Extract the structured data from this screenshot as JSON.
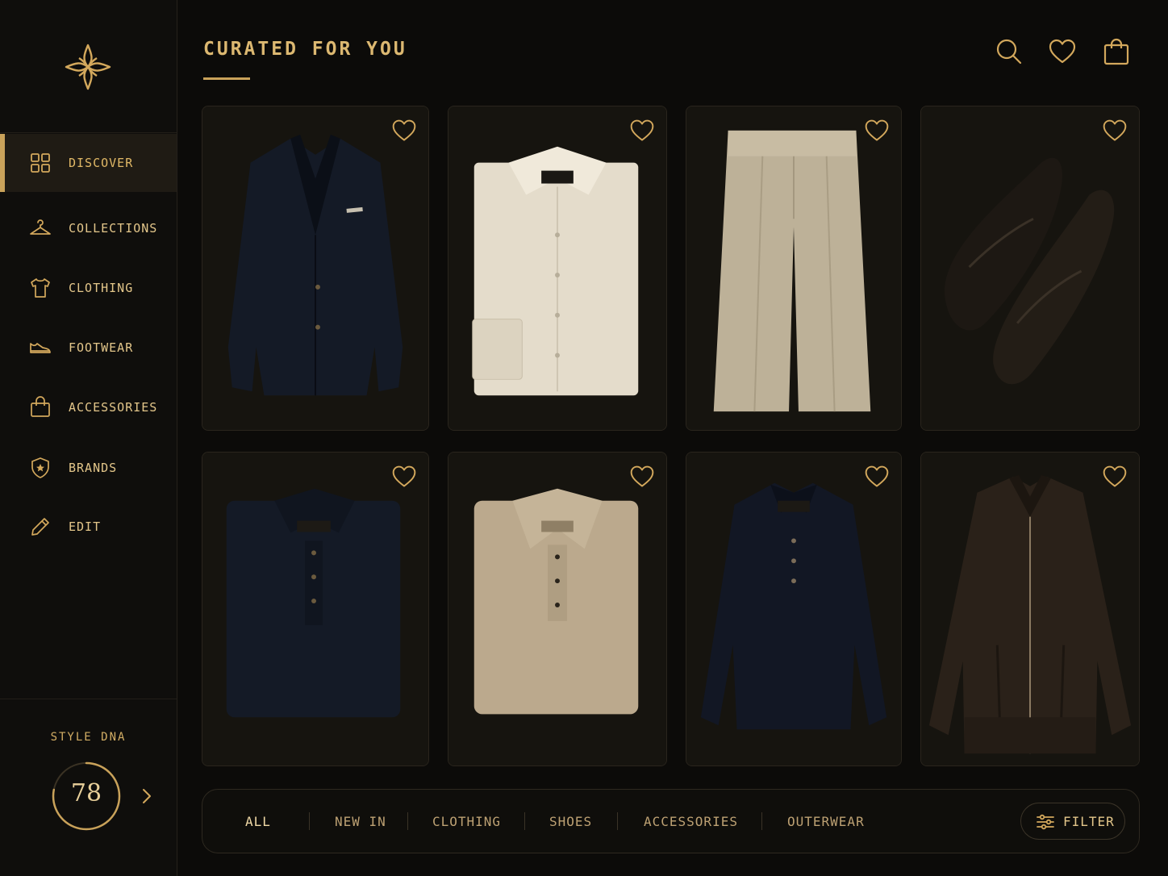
{
  "brand": {
    "logo_icon": "quatrefoil-star-icon"
  },
  "colors": {
    "background": "#0c0b09",
    "accent": "#c9a25a",
    "text": "#d8b46a",
    "card": "#16140f"
  },
  "header": {
    "title": "CURATED FOR YOU",
    "icons": [
      "search-icon",
      "heart-icon",
      "shopping-bag-icon"
    ]
  },
  "sidebar": {
    "items": [
      {
        "label": "DISCOVER",
        "icon": "grid-icon",
        "active": true
      },
      {
        "label": "COLLECTIONS",
        "icon": "hanger-icon",
        "active": false
      },
      {
        "label": "CLOTHING",
        "icon": "tshirt-icon",
        "active": false
      },
      {
        "label": "FOOTWEAR",
        "icon": "shoe-icon",
        "active": false
      },
      {
        "label": "ACCESSORIES",
        "icon": "bag-icon",
        "active": false
      },
      {
        "label": "BRANDS",
        "icon": "shield-star-icon",
        "active": false
      },
      {
        "label": "EDIT",
        "icon": "pencil-icon",
        "active": false
      }
    ],
    "style_dna": {
      "title": "STYLE DNA",
      "score": "78",
      "progress": 0.78
    }
  },
  "products": [
    {
      "item": "navy blazer",
      "icon": "blazer-image"
    },
    {
      "item": "cream dress shirt",
      "icon": "shirt-image"
    },
    {
      "item": "khaki pleated trousers",
      "icon": "trousers-image"
    },
    {
      "item": "black penny loafers",
      "icon": "loafers-image"
    },
    {
      "item": "navy knit polo",
      "icon": "polo-image"
    },
    {
      "item": "beige knit polo",
      "icon": "polo-image"
    },
    {
      "item": "navy long-sleeve polo",
      "icon": "polo-longsleeve-image"
    },
    {
      "item": "brown leather jacket",
      "icon": "leather-jacket-image"
    }
  ],
  "filters": {
    "tabs": [
      {
        "label": "ALL",
        "active": true
      },
      {
        "label": "NEW IN",
        "active": false
      },
      {
        "label": "CLOTHING",
        "active": false
      },
      {
        "label": "SHOES",
        "active": false
      },
      {
        "label": "ACCESSORIES",
        "active": false
      },
      {
        "label": "OUTERWEAR",
        "active": false
      }
    ],
    "filter_label": "FILTER"
  }
}
